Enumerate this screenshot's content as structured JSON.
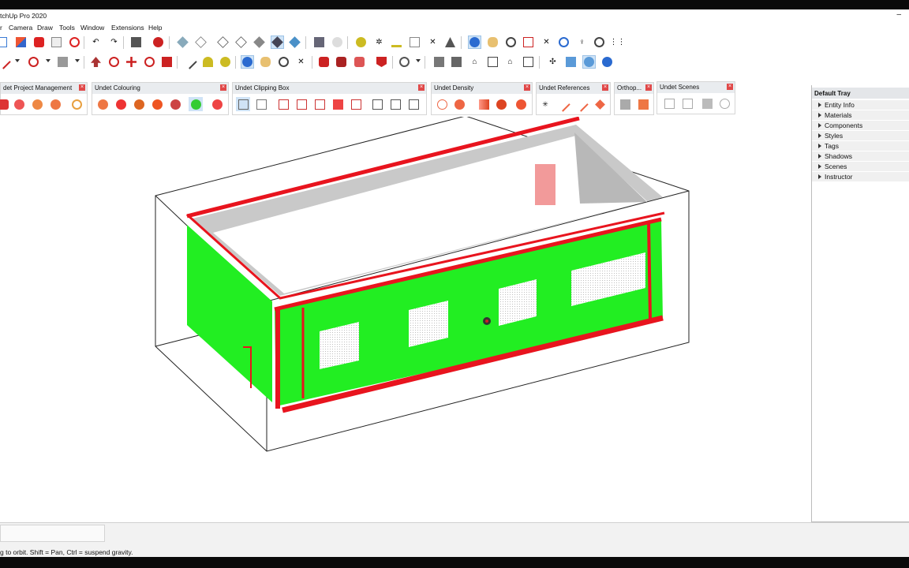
{
  "app": {
    "title": "tchUp Pro 2020"
  },
  "menu": [
    "r",
    "Camera",
    "Draw",
    "Tools",
    "Window",
    "Extensions",
    "Help"
  ],
  "toolbar_icons": {
    "row1": [
      "select-icon",
      "eraser-icon",
      "paint-bucket-icon",
      "delete-icon",
      "undo-icon",
      "redo-icon",
      "print-icon",
      "model-info-icon",
      "xray-icon",
      "back-edges-icon",
      "wireframe-icon",
      "hidden-line-icon",
      "shaded-icon",
      "shaded-textures-icon",
      "monochrome-icon",
      "components-icon",
      "tape-measure-icon",
      "dimension-icon",
      "protractor-icon",
      "text-icon",
      "axes-icon",
      "3d-text-icon",
      "orbit-icon",
      "pan-icon",
      "zoom-icon",
      "zoom-window-icon",
      "zoom-extents-icon",
      "position-camera-icon",
      "look-around-icon",
      "walk-icon"
    ],
    "row2": [
      "line-icon",
      "arc-icon",
      "rectangle-icon",
      "push-pull-icon",
      "follow-me-icon",
      "move-icon",
      "rotate-icon",
      "scale-icon",
      "offset-icon",
      "tape-icon",
      "protractor-icon",
      "axes-icon",
      "text-icon",
      "3d-warehouse-icon",
      "extension-warehouse-icon",
      "sandbox-icon",
      "iso-view-icon",
      "top-view-icon",
      "front-view-icon",
      "right-view-icon",
      "back-view-icon",
      "left-view-icon",
      "section-plane-icon",
      "display-section-planes-icon",
      "display-section-cuts-icon"
    ]
  },
  "panels": [
    {
      "title": "det Project Management"
    },
    {
      "title": "Undet Colouring"
    },
    {
      "title": "Undet Clipping Box"
    },
    {
      "title": "Undet Density"
    },
    {
      "title": "Undet References"
    },
    {
      "title": "Orthop..."
    },
    {
      "title": "Undet Scenes"
    }
  ],
  "tray": {
    "title": "Default Tray",
    "items": [
      "Entity Info",
      "Materials",
      "Components",
      "Styles",
      "Tags",
      "Shadows",
      "Scenes",
      "Instructor"
    ]
  },
  "status": {
    "text": "g to orbit. Shift = Pan, Ctrl = suspend gravity.",
    "measurements_value": ""
  },
  "colors": {
    "point_green": "#22ee22",
    "point_red": "#e8141e",
    "wall_gray": "#c4c4c4",
    "close_red": "#e04848",
    "pressed_blue": "#cfe3f6"
  }
}
